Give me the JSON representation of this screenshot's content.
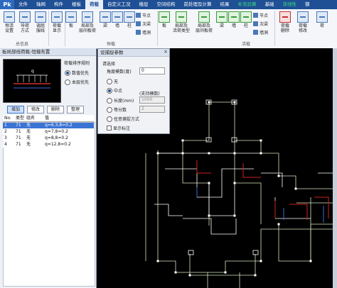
{
  "menu": {
    "logo": "Pk",
    "tabs": [
      "文件",
      "轴网",
      "构件",
      "楼板",
      "荷载",
      "自定义工况",
      "楼层",
      "空间结构",
      "前处理及计算",
      "结果",
      "补充验算",
      "基础",
      "非线性",
      "钢"
    ],
    "active_tab": "荷载"
  },
  "ribbon": {
    "buttons": {
      "b1": "恒活\n设置",
      "b2": "导荷\n方式",
      "b3": "调屈\n服线",
      "b4": "荷载\n显示",
      "b5": "板",
      "b6": "局部及\n层间板荷",
      "b7": "梁",
      "b8": "墙",
      "b9": "柱",
      "b10": "节点",
      "b11": "次梁",
      "b12": "墙洞",
      "b13": "板",
      "b14": "局部及\n活荷类型",
      "b15": "局部及\n层间板荷",
      "b16": "梁",
      "b17": "墙",
      "b18": "柱",
      "b19": "节点",
      "b20": "次梁",
      "b21": "墙洞",
      "b22": "荷载\n删除",
      "b23": "荷载\n修改",
      "b24": "荷"
    },
    "groups": [
      "总信息",
      "恒载",
      "活载"
    ]
  },
  "left_panel": {
    "title": "板局部线荷载-恒载布置",
    "preview_label": "q",
    "sort_title": "荷载排序规则",
    "options": [
      "数值优先",
      "本层优先"
    ],
    "selected_option": 0,
    "buttons": [
      "增加",
      "修改",
      "删除",
      "整理"
    ],
    "active_button": 0,
    "table": {
      "headers": [
        "No.",
        "类型",
        "组名",
        "值"
      ],
      "rows": [
        [
          "1",
          "71",
          "无",
          "q=6.3,8=0.2"
        ],
        [
          "2",
          "71",
          "无",
          "q=7,8=0.2"
        ],
        [
          "3",
          "71",
          "无",
          "q=8,8=0.2"
        ],
        [
          "4",
          "71",
          "无",
          "q=12,8=0.2"
        ]
      ],
      "selected_row": 0
    }
  },
  "dialog": {
    "title": "设捕捉参数",
    "close": "×",
    "subtitle": "请选择",
    "angle_label": "角度模数(度)",
    "angle_value": "0",
    "options": [
      "无",
      "中点",
      "长度(mm)",
      "等分数",
      "任意捕捉方式"
    ],
    "selected_option": 1,
    "support_note": "(支持模数)",
    "length_value": "1000",
    "divide_value": "2",
    "show_mark": "显示标注"
  },
  "colors": {
    "menubar": "#1f4f94",
    "active_tab": "#e8eef8",
    "selected_row": "#3b73d4",
    "canvas_bg": "#000000",
    "grid_line": "#d8e8c0",
    "white_line": "#ffffff",
    "red_line": "#d02020",
    "blue_line": "#3a6ad8"
  }
}
